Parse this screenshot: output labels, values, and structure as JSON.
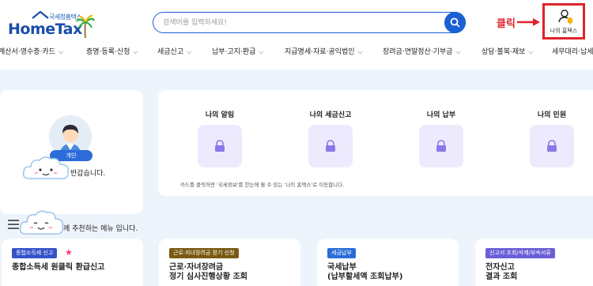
{
  "header": {
    "logo_sub": "국세청홈택스",
    "logo_main": "HomeTax",
    "search_placeholder": "검색어를 입력하세요!",
    "annotation_label": "클릭",
    "my_hometax_label": "나의 홈택스",
    "accent_color": "#1a5fd4",
    "annotation_color": "#e0232b"
  },
  "gnb": {
    "items": [
      {
        "label": "계산서·영수증·카드"
      },
      {
        "label": "증명·등록·신청"
      },
      {
        "label": "세금신고"
      },
      {
        "label": "납부·고지·환급"
      },
      {
        "label": "지급명세·자료·공익법인"
      },
      {
        "label": "장려금·연말정산·기부금"
      },
      {
        "label": "상담·불복·제보"
      },
      {
        "label": "세무대리·납세"
      }
    ]
  },
  "welcome": {
    "badge": "개인",
    "text": "반갑습니다."
  },
  "mynts": {
    "items": [
      {
        "title": "나의 알림",
        "icon": "lock-icon"
      },
      {
        "title": "나의 세금신고",
        "icon": "lock-icon"
      },
      {
        "title": "나의 납부",
        "icon": "lock-icon"
      },
      {
        "title": "나의 민원",
        "icon": "lock-icon"
      }
    ],
    "note": "카드를 클릭하면 '국세정보'를 한눈에 볼 수 있는 '나의 홈택스'로 이동합니다."
  },
  "recommend": {
    "text": "께 추천하는 메뉴 입니다."
  },
  "services": [
    {
      "tag": "종합소득세 신고",
      "tag_color": "#3553c8",
      "title": "종합소득세 원클릭 환급신고",
      "starred": true
    },
    {
      "tag": "근로·자녀장려금 정기 신청",
      "tag_color": "#7a5a12",
      "title": "근로·자녀장려금\n정기 심사진행상황 조회",
      "starred": false
    },
    {
      "tag": "세금납부",
      "tag_color": "#2c6cd8",
      "title": "국세납부\n(납부할세액 조회납부)",
      "starred": false
    },
    {
      "tag": "신고서 조회/삭제/부속서류",
      "tag_color": "#6b5fd6",
      "title": "전자신고\n결과 조회",
      "starred": false
    }
  ]
}
